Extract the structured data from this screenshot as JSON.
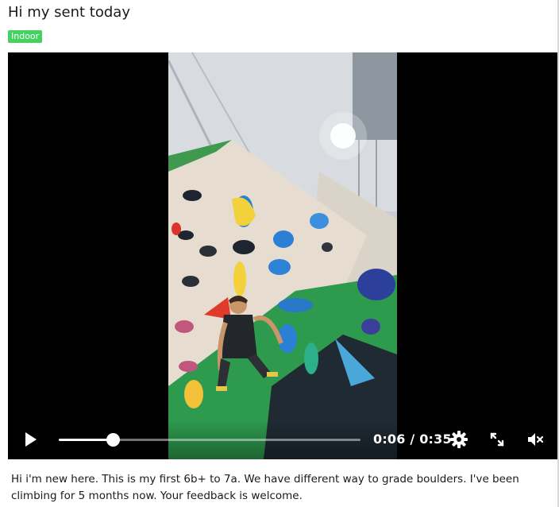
{
  "post": {
    "title": "Hi my sent today",
    "flair": "Indoor",
    "body": "Hi i'm new here. This is my first 6b+ to 7a. We have different way to grade boulders. I've been climbing for 5 months now. Your feedback is welcome."
  },
  "video": {
    "current_time": "0:06",
    "duration": "0:35",
    "separator": "/",
    "progress": 0.18
  },
  "icons": {
    "play": "play-icon",
    "settings": "gear-icon",
    "fullscreen": "expand-icon",
    "mute": "volume-muted-icon"
  },
  "colors": {
    "flair_bg": "#46d160",
    "player_bg": "#000000",
    "controls_fg": "#ffffff"
  }
}
